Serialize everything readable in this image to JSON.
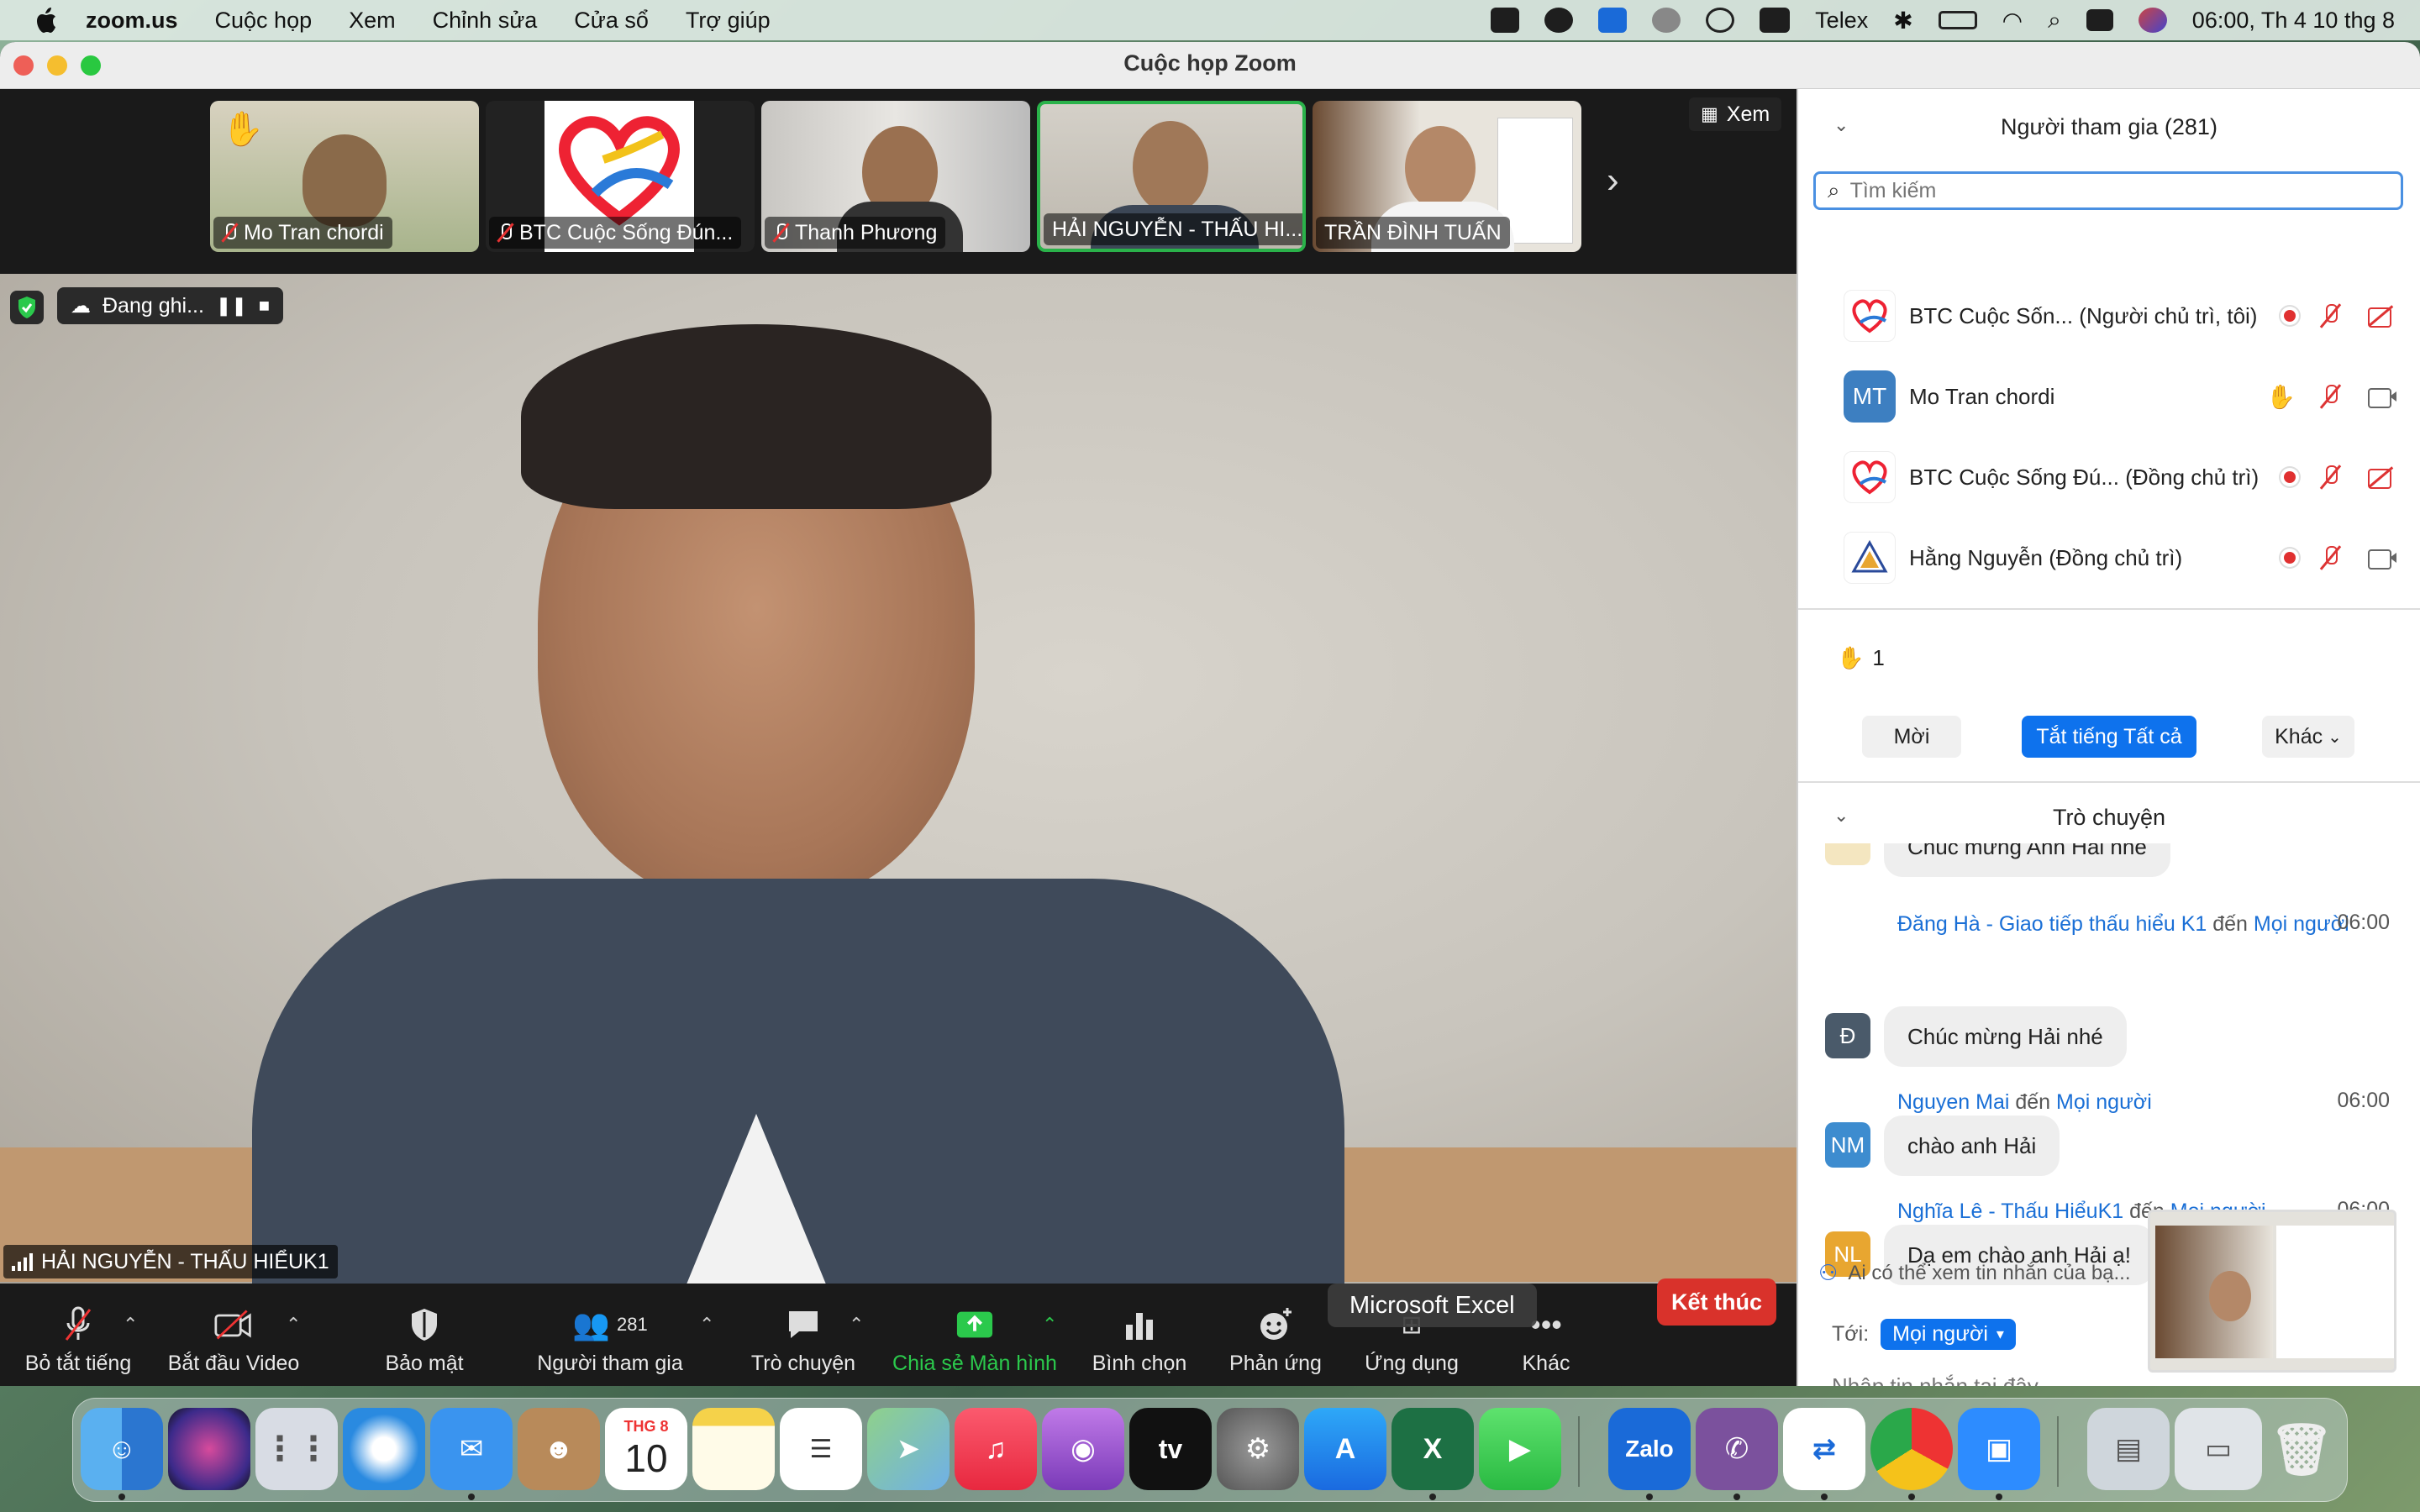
{
  "menubar": {
    "app_name": "zoom.us",
    "menus": [
      "Cuộc họp",
      "Xem",
      "Chỉnh sửa",
      "Cửa sổ",
      "Trợ giúp"
    ],
    "input_method": "Telex",
    "clock": "06:00, Th 4 10 thg 8"
  },
  "window": {
    "title": "Cuộc họp Zoom"
  },
  "gallery": {
    "view_label": "Xem",
    "thumbs": [
      {
        "name": "Mo Tran chordi",
        "muted": true,
        "hand_raised": true
      },
      {
        "name": "BTC Cuộc Sống Đún...",
        "muted": true
      },
      {
        "name": "Thanh Phương",
        "muted": true
      },
      {
        "name": "HẢI NGUYỄN - THẤU HI...",
        "muted": false,
        "active": true
      },
      {
        "name": "TRẦN ĐÌNH TUẤN",
        "muted": false
      }
    ]
  },
  "main_video": {
    "recording_label": "Đang ghi...",
    "speaker_name": "HẢI NGUYỄN - THẤU HIỂUK1"
  },
  "toolbar": {
    "unmute": "Bỏ tắt tiếng",
    "start_video": "Bắt đầu Video",
    "security": "Bảo mật",
    "participants": "Người tham gia",
    "participants_count": "281",
    "chat": "Trò chuyện",
    "share": "Chia sẻ Màn hình",
    "poll": "Bình chọn",
    "reactions": "Phản ứng",
    "apps": "Ứng dụng",
    "more": "Khác",
    "end": "Kết thúc",
    "tooltip": "Microsoft Excel"
  },
  "participants_panel": {
    "title": "Người tham gia (281)",
    "search_placeholder": "Tìm kiếm",
    "list": [
      {
        "name": "BTC Cuộc Sốn...  (Người chủ trì, tôi)",
        "avatar": "logo"
      },
      {
        "name": "Mo Tran chordi",
        "avatar": "MT",
        "avatar_color": "#3d7fc1"
      },
      {
        "name": "BTC Cuộc Sống Đú... (Đồng chủ trì)",
        "avatar": "logo"
      },
      {
        "name": "Hằng Nguyễn (Đồng chủ trì)",
        "avatar": "logo2"
      }
    ],
    "raised_hands": "1",
    "invite": "Mời",
    "mute_all": "Tắt tiếng Tất cả",
    "more": "Khác"
  },
  "chat_panel": {
    "title": "Trò chuyện",
    "messages": [
      {
        "text": "Chúc mừng Anh Hải nhé"
      },
      {
        "from": "Đăng Hà - Giao tiếp thấu hiểu K1",
        "to": "Mọi người",
        "time": "06:00",
        "avatar": "Đ",
        "avatar_color": "#4a5a6a",
        "text": "Chúc mừng Hải nhé"
      },
      {
        "from": "Nguyen Mai",
        "to": "Mọi người",
        "time": "06:00",
        "avatar": "NM",
        "avatar_color": "#3d8ccf",
        "text": "chào anh Hải"
      },
      {
        "from": "Nghĩa Lê - Thấu HiểuK1",
        "to": "Mọi người",
        "time": "06:00",
        "avatar": "NL",
        "avatar_color": "#e8a630",
        "text": "Dạ em chào anh Hải ạ!"
      }
    ],
    "word_to": "đến",
    "visibility_note": "Ai có thể xem tin nhắn của bạ...",
    "to_label": "Tới:",
    "to_value": "Mọi người",
    "input_placeholder": "Nhập tin nhắn tại đây..."
  },
  "dock": {
    "calendar_month": "THG 8",
    "calendar_day": "10",
    "apps": [
      "finder",
      "siri",
      "launchpad",
      "safari",
      "mail",
      "contacts",
      "calendar",
      "notes",
      "reminders",
      "maps",
      "music",
      "podcasts",
      "tv",
      "system-preferences",
      "app-store",
      "excel",
      "facetime",
      "zalo",
      "viber",
      "teamviewer",
      "chrome",
      "zoom",
      "downloads",
      "windows",
      "trash"
    ],
    "zalo_label": "Zalo",
    "tv_label": "tv"
  }
}
